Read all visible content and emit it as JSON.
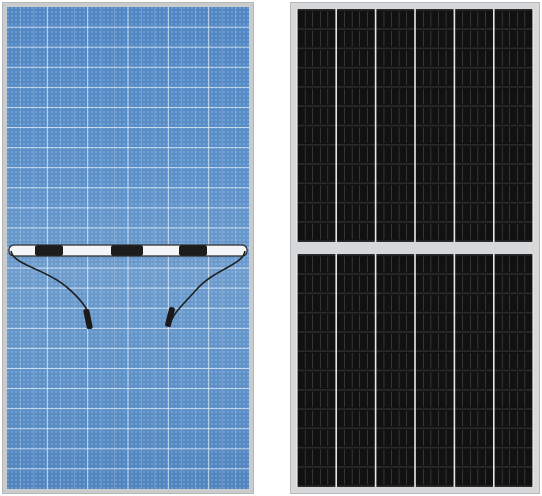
{
  "scene": {
    "subject": "two-solar-panels",
    "left_panel": {
      "type": "bifacial",
      "cell_color": "#5b90c9",
      "frame_color": "#c9cbcd",
      "columns": 6,
      "rows": 24,
      "junction_boxes": 3
    },
    "right_panel": {
      "type": "monocrystalline-half-cut",
      "cell_color": "#111111",
      "frame_color": "#d7d8d9",
      "columns": 6,
      "rows_per_half": 12
    }
  }
}
